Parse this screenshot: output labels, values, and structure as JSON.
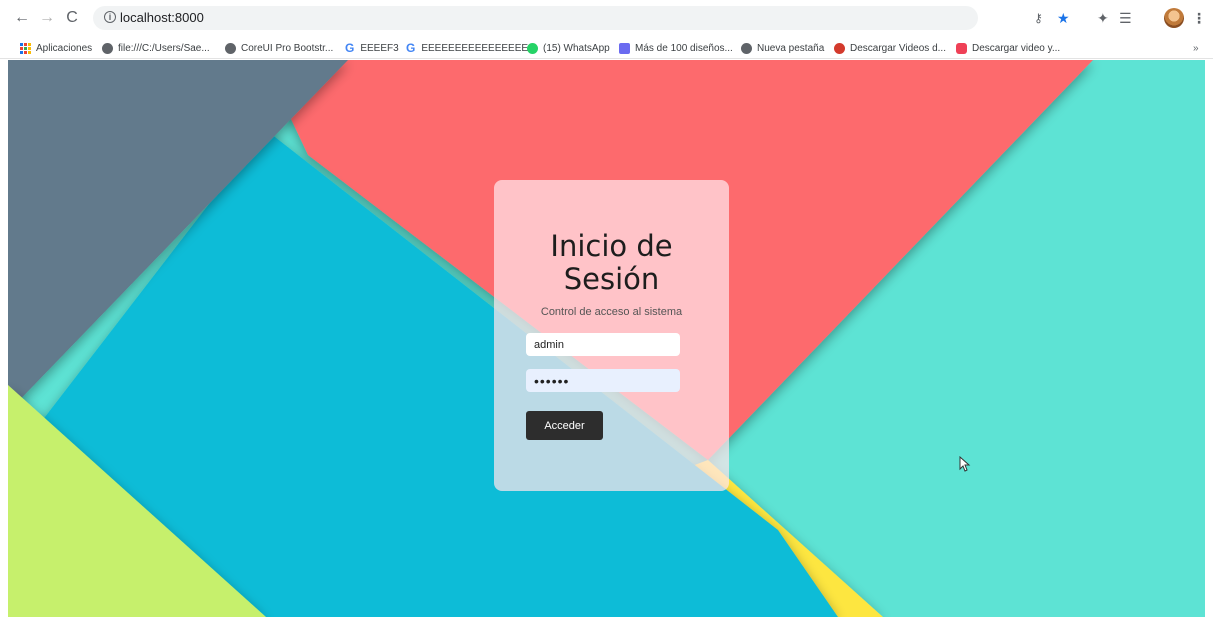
{
  "browser": {
    "url": "localhost:8000",
    "nav": {
      "back": "←",
      "forward": "→",
      "reload": "C"
    }
  },
  "bookmarks": [
    {
      "label": "Aplicaciones",
      "icon": "apps-grid-icon"
    },
    {
      "label": "file:///C:/Users/Sae...",
      "icon": "globe-icon"
    },
    {
      "label": "CoreUI Pro Bootstr...",
      "icon": "globe-icon"
    },
    {
      "label": "EEEEF3",
      "icon": "google-icon"
    },
    {
      "label": "EEEEEEEEEEEEEEEE...",
      "icon": "google-icon"
    },
    {
      "label": "(15) WhatsApp",
      "icon": "whatsapp-icon"
    },
    {
      "label": "Más de 100 diseños...",
      "icon": "bookmark-icon"
    },
    {
      "label": "Nueva pestaña",
      "icon": "globe-icon"
    },
    {
      "label": "Descargar Videos d...",
      "icon": "tomato-icon"
    },
    {
      "label": "Descargar video y...",
      "icon": "pocket-icon"
    }
  ],
  "bookmarks_more": "»",
  "login": {
    "title_line1": "Inicio de",
    "title_line2": "Sesión",
    "subtitle": "Control de acceso al sistema",
    "username_value": "admin",
    "password_value": "••••••",
    "submit_label": "Acceder"
  },
  "colors": {
    "slate": "#627a8c",
    "coral": "#fd6b6d",
    "blue": "#10bcd7",
    "teal": "#5de3d4",
    "lime": "#c6f06c",
    "yellow": "#fde640"
  }
}
